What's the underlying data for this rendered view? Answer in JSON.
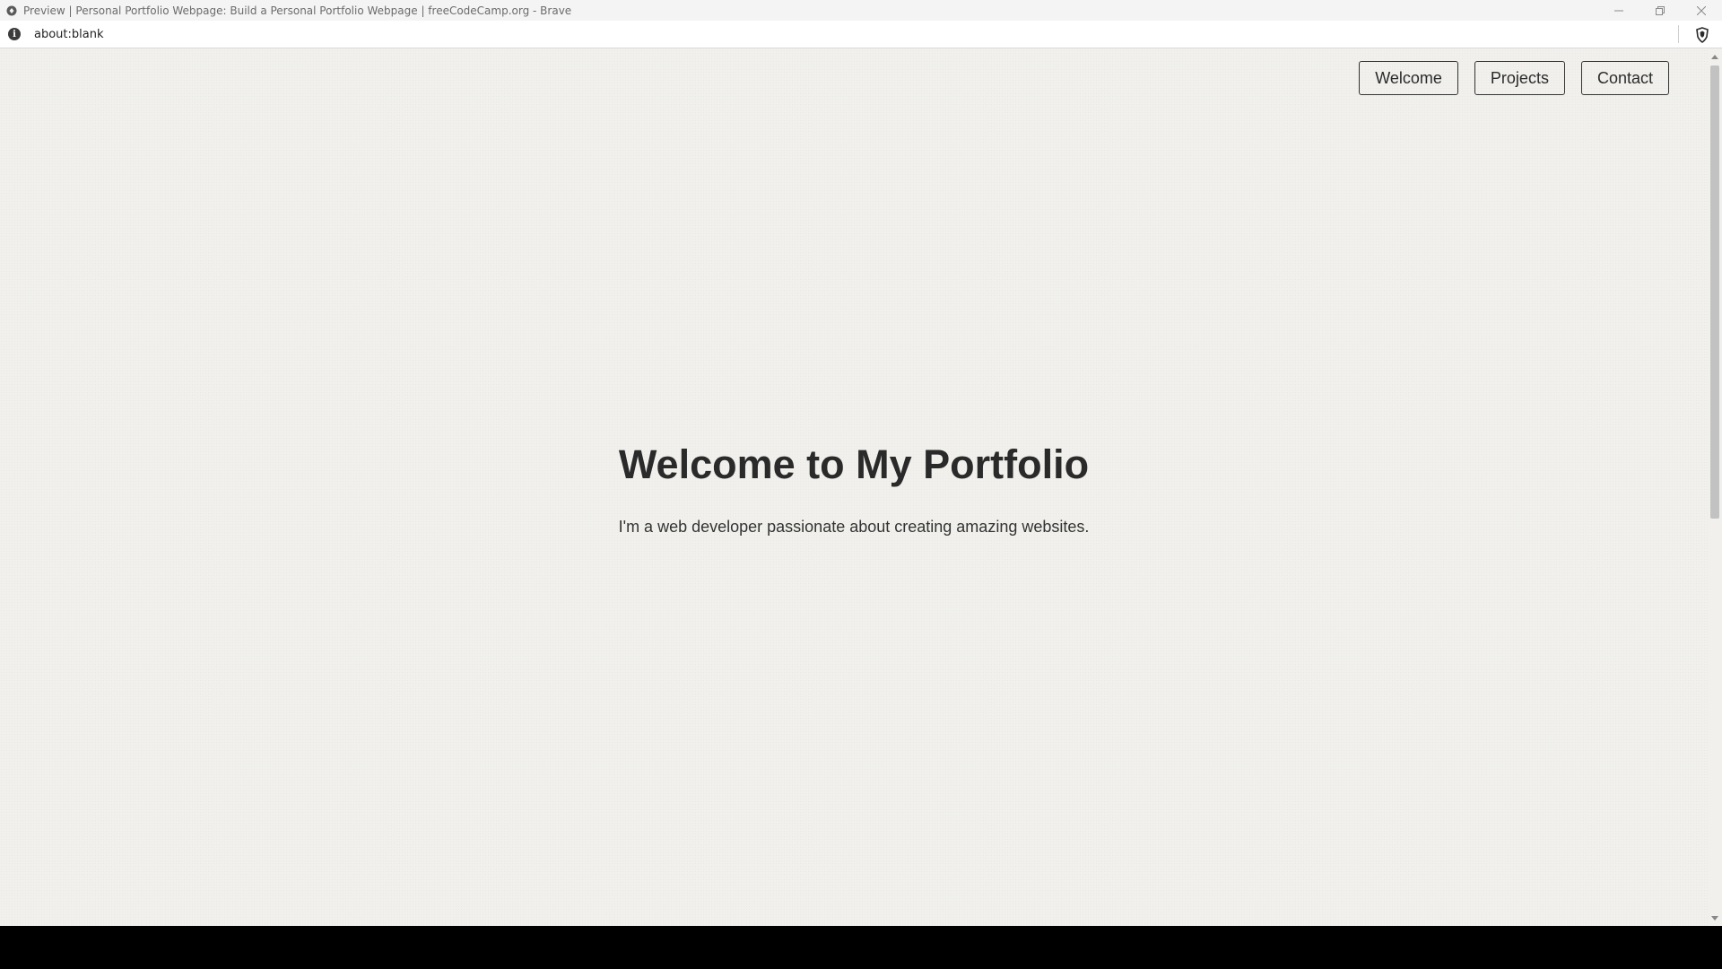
{
  "browser": {
    "window_title": "Preview | Personal Portfolio Webpage: Build a Personal Portfolio Webpage | freeCodeCamp.org - Brave",
    "address": "about:blank",
    "icons": {
      "app": "brave-logo-icon",
      "info": "info-icon",
      "shield": "brave-shield-icon",
      "minimize": "minimize-icon",
      "restore": "restore-icon",
      "close": "close-icon"
    }
  },
  "page": {
    "nav": {
      "items": [
        {
          "label": "Welcome"
        },
        {
          "label": "Projects"
        },
        {
          "label": "Contact"
        }
      ]
    },
    "hero": {
      "title": "Welcome to My Portfolio",
      "subtitle": "I'm a web developer passionate about creating amazing websites."
    }
  },
  "colors": {
    "page_background": "#f1f0ec",
    "text": "#2a2a2a",
    "button_border": "#333333"
  }
}
